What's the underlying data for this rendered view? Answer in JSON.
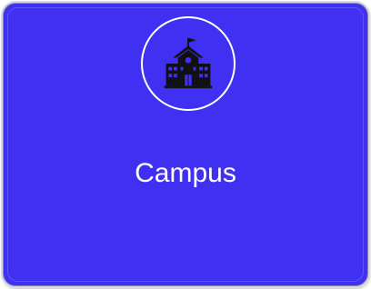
{
  "tile": {
    "label": "Campus",
    "icon": "school-building-icon",
    "background_color": "#4030f2",
    "text_color": "#ffffff"
  }
}
